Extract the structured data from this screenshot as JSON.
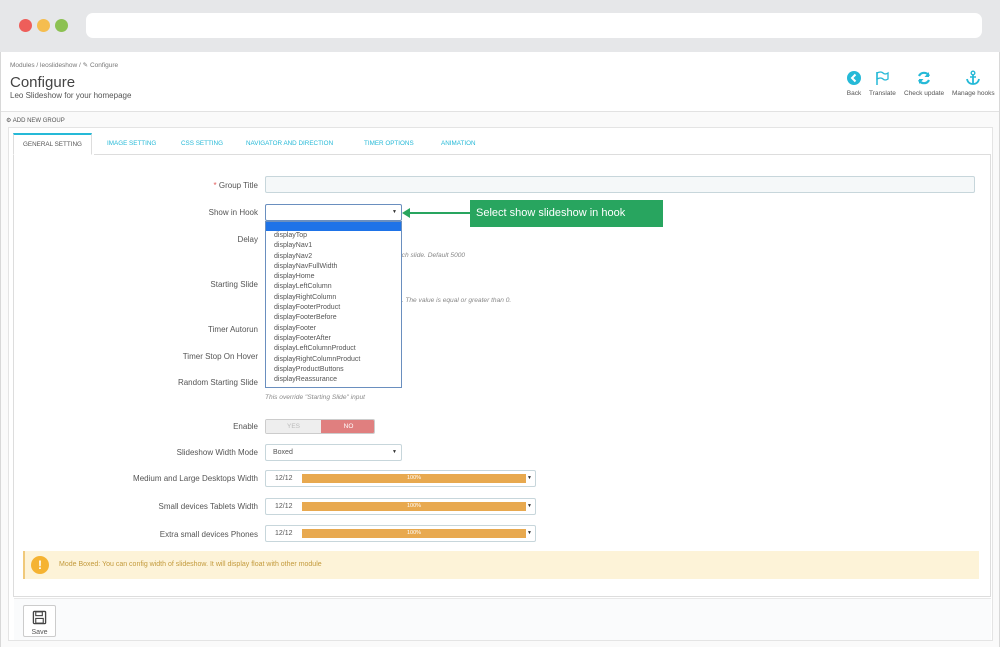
{
  "breadcrumb": {
    "item1": "Modules",
    "sep1": "/",
    "item2": "leoslideshow",
    "sep2": "/",
    "item3": "Configure"
  },
  "header": {
    "title": "Configure",
    "subtitle": "Leo Slideshow for your homepage",
    "toolbar": {
      "back": "Back",
      "translate": "Translate",
      "check_update": "Check update",
      "manage_hooks": "Manage hooks"
    }
  },
  "panel": {
    "heading": "ADD NEW GROUP"
  },
  "tabs": [
    {
      "label": "GENERAL SETTING"
    },
    {
      "label": "IMAGE SETTING"
    },
    {
      "label": "CSS SETTING"
    },
    {
      "label": "NAVIGATOR AND DIRECTION"
    },
    {
      "label": "TIMER OPTIONS"
    },
    {
      "label": "ANIMATION"
    }
  ],
  "form": {
    "group_title": {
      "required_mark": "*",
      "label": "Group Title",
      "value": ""
    },
    "show_in_hook": {
      "label": "Show in Hook",
      "value": ""
    },
    "delay": {
      "label": "Delay",
      "help": "ach slide. Default 5000"
    },
    "starting_slide": {
      "label": "Starting Slide",
      "help": "0. The value is equal or greater than 0."
    },
    "timer_autorun": {
      "label": "Timer Autorun"
    },
    "timer_stop_on_hover": {
      "label": "Timer Stop On Hover"
    },
    "random_starting_slide": {
      "label": "Random Starting Slide",
      "help": "This override \"Starting Slide\" input"
    },
    "enable": {
      "label": "Enable",
      "yes": "YES",
      "no": "NO"
    },
    "width_mode": {
      "label": "Slideshow Width Mode",
      "value": "Boxed"
    },
    "width_rows": [
      {
        "label": "Medium and Large Desktops Width",
        "value": "12/12",
        "percent": "100%"
      },
      {
        "label": "Small devices Tablets Width",
        "value": "12/12",
        "percent": "100%"
      },
      {
        "label": "Extra small devices Phones",
        "value": "12/12",
        "percent": "100%"
      }
    ]
  },
  "hook_options": [
    "displayTop",
    "displayNav1",
    "displayNav2",
    "displayNavFullWidth",
    "displayHome",
    "displayLeftColumn",
    "displayRightColumn",
    "displayFooterProduct",
    "displayFooterBefore",
    "displayFooter",
    "displayFooterAfter",
    "displayLeftColumnProduct",
    "displayRightColumnProduct",
    "displayProductButtons",
    "displayReassurance"
  ],
  "callout": "Select show slideshow in hook",
  "warning": {
    "icon": "!",
    "text": "Mode Boxed: You can config width of slideshow. It will display float with other module"
  },
  "footer": {
    "save_label": "Save"
  },
  "colors": {
    "accent": "#25b9d7",
    "callout_green": "#28a55f",
    "bar_orange": "#e8a94f",
    "no_red": "#e07f7f",
    "warning_bg": "#fdf3d8"
  }
}
